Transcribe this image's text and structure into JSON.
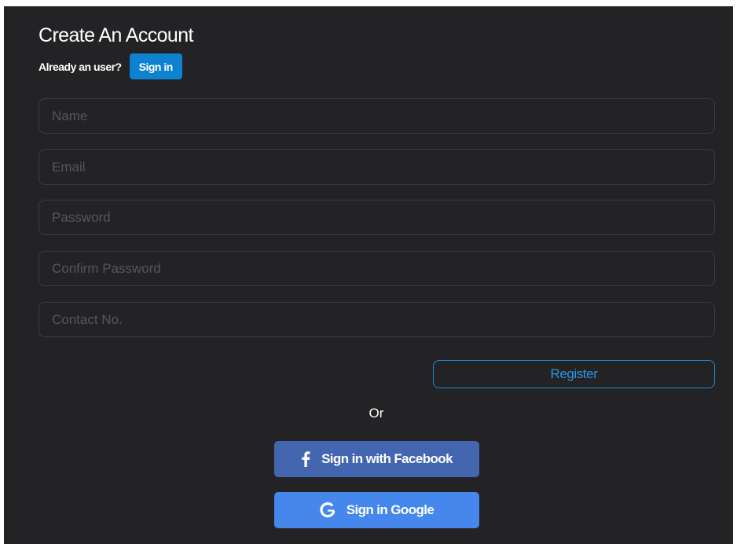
{
  "header": {
    "title": "Create An Account",
    "already_text": "Already an user?",
    "signin_label": "Sign in"
  },
  "form": {
    "fields": [
      {
        "name": "name-input",
        "placeholder": "Name",
        "value": ""
      },
      {
        "name": "email-input",
        "placeholder": "Email",
        "value": ""
      },
      {
        "name": "password-input",
        "placeholder": "Password",
        "value": ""
      },
      {
        "name": "confirm-password-input",
        "placeholder": "Confirm Password",
        "value": ""
      },
      {
        "name": "contact-input",
        "placeholder": "Contact No.",
        "value": ""
      }
    ],
    "register_label": "Register"
  },
  "divider": {
    "or_label": "Or"
  },
  "social": {
    "facebook": {
      "label": "Sign in with Facebook",
      "icon": "facebook-icon",
      "color": "#4466b0"
    },
    "google": {
      "label": "Sign in Google",
      "icon": "google-icon",
      "color": "#4687ee"
    }
  },
  "colors": {
    "background": "#232325",
    "accent": "#0d82d0",
    "register_border": "#1b8ad8"
  }
}
